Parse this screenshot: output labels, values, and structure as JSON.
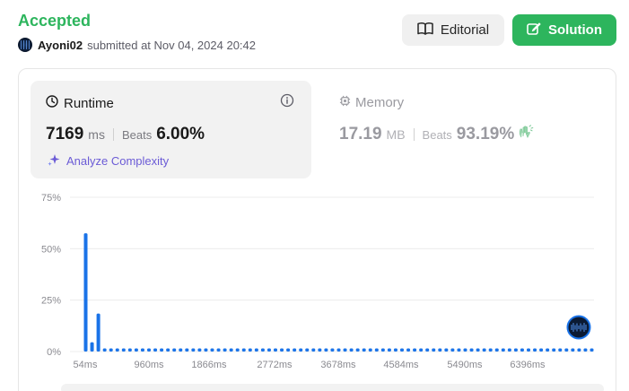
{
  "header": {
    "status": "Accepted",
    "username": "Ayoni02",
    "submitted_text": "submitted at Nov 04, 2024 20:42",
    "editorial_label": "Editorial",
    "solution_label": "Solution"
  },
  "runtime": {
    "title": "Runtime",
    "value": "7169",
    "unit": "ms",
    "beats_label": "Beats",
    "beats_value": "6.00%",
    "analyze_label": "Analyze Complexity"
  },
  "memory": {
    "title": "Memory",
    "value": "17.19",
    "unit": "MB",
    "beats_label": "Beats",
    "beats_value": "93.19%"
  },
  "colors": {
    "accent_green": "#2db55d",
    "bar_blue": "#1a73e8",
    "analyze_purple": "#6b5bd6"
  },
  "chart_data": {
    "type": "bar",
    "y_ticks": [
      "75%",
      "50%",
      "25%",
      "0%"
    ],
    "y_values": [
      75,
      50,
      25,
      0
    ],
    "ylim": [
      0,
      75
    ],
    "x_ticks": [
      "54ms",
      "960ms",
      "1866ms",
      "2772ms",
      "3678ms",
      "4584ms",
      "5490ms",
      "6396ms"
    ],
    "values": [
      57.5,
      4.5,
      18.5,
      1.5,
      1.5,
      1.5,
      1.5,
      1.5,
      1.5,
      1.5,
      1.5,
      1.5,
      1.5,
      1.5,
      1.5,
      1.5,
      1.5,
      1.5,
      1.5,
      1.5,
      1.5,
      1.5,
      1.5,
      1.5,
      1.5,
      1.5,
      1.5,
      1.5,
      1.5,
      1.5,
      1.5,
      1.5,
      1.5,
      1.5,
      1.5,
      1.5,
      1.5,
      1.5,
      1.5,
      1.5,
      1.5,
      1.5,
      1.5,
      1.5,
      1.5,
      1.5,
      1.5,
      1.5,
      1.5,
      1.5,
      1.5,
      1.5,
      1.5,
      1.5,
      1.5,
      1.5,
      1.5,
      1.5,
      1.5,
      1.5,
      1.5,
      1.5,
      1.5,
      1.5,
      1.5,
      1.5,
      1.5,
      1.5,
      1.5,
      1.5,
      1.5,
      1.5,
      1.5,
      1.5,
      1.5,
      1.5,
      1.5,
      1.5,
      1.5,
      1.5,
      1.5
    ],
    "grid": true,
    "user_marker_index": 78
  }
}
